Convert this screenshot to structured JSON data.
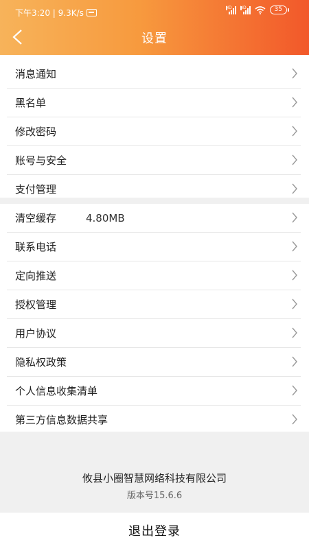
{
  "status_bar": {
    "time_speed": "下午3:20 | 9.3K/s",
    "hd_label": "HD",
    "battery": "35"
  },
  "header": {
    "title": "设置",
    "back_icon": "chevron-left-icon"
  },
  "settings_group_1": [
    {
      "label": "消息通知"
    },
    {
      "label": "黑名单"
    },
    {
      "label": "修改密码"
    },
    {
      "label": "账号与安全"
    },
    {
      "label": "支付管理"
    }
  ],
  "settings_group_2": [
    {
      "label": "清空缓存",
      "value": "4.80MB"
    },
    {
      "label": "联系电话"
    },
    {
      "label": "定向推送"
    },
    {
      "label": "授权管理"
    },
    {
      "label": "用户协议"
    },
    {
      "label": "隐私权政策"
    },
    {
      "label": "个人信息收集清单"
    },
    {
      "label": "第三方信息数据共享"
    }
  ],
  "footer": {
    "company": "攸县小圈智慧网络科技有限公司",
    "version": "版本号15.6.6"
  },
  "logout_label": "退出登录",
  "colors": {
    "header_start": "#f7b35a",
    "header_end": "#f2582a",
    "separator": "#f0f0f0",
    "chevron": "#999999"
  }
}
